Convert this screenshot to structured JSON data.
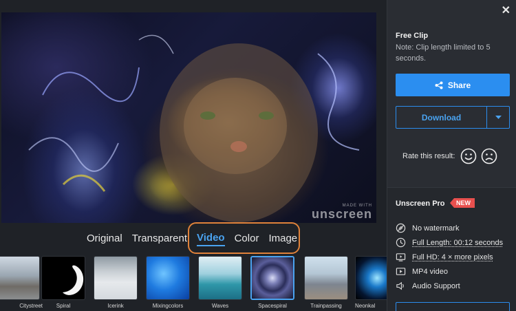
{
  "preview": {
    "watermark_small": "MADE WITH",
    "watermark_brand": "unscreen"
  },
  "tabs": [
    {
      "label": "Original",
      "active": false
    },
    {
      "label": "Transparent",
      "active": false
    },
    {
      "label": "Video",
      "active": true
    },
    {
      "label": "Color",
      "active": false
    },
    {
      "label": "Image",
      "active": false
    }
  ],
  "thumbnails": [
    {
      "label": "Citystreet",
      "selected": false
    },
    {
      "label": "Spiral",
      "selected": false
    },
    {
      "label": "Icerink",
      "selected": false
    },
    {
      "label": "Mixingcolors",
      "selected": false
    },
    {
      "label": "Waves",
      "selected": false
    },
    {
      "label": "Spacespiral",
      "selected": true
    },
    {
      "label": "Trainpassing",
      "selected": false
    },
    {
      "label": "Neonkal",
      "selected": false
    }
  ],
  "panel": {
    "close_icon": "✕",
    "clip_title": "Free Clip",
    "clip_note": "Note: Clip length limited to 5 seconds.",
    "share_label": "Share",
    "download_label": "Download",
    "rate_label": "Rate this result:",
    "pro_title": "Unscreen Pro",
    "pro_badge": "NEW",
    "features": [
      {
        "icon": "no-watermark-icon",
        "label": "No watermark",
        "link": false
      },
      {
        "icon": "clock-icon",
        "label": "Full Length: 00:12 seconds",
        "link": true
      },
      {
        "icon": "hd-icon",
        "label": "Full HD: 4 × more pixels",
        "link": true
      },
      {
        "icon": "video-icon",
        "label": "MP4 video",
        "link": false
      },
      {
        "icon": "speaker-icon",
        "label": "Audio Support",
        "link": false
      }
    ]
  },
  "colors": {
    "accent": "#2b8ef0",
    "highlight": "#e0823a",
    "badge": "#e8504e"
  }
}
